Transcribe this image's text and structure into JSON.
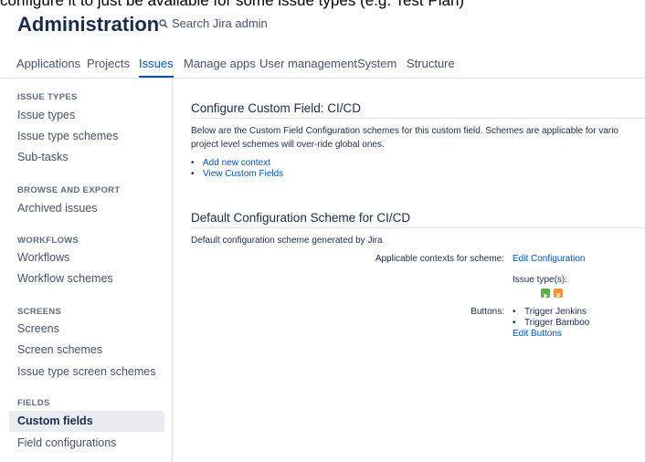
{
  "caption_cut": "configure it to just be available for some issue types (e.g. Test Plan)",
  "header": {
    "title": "Administration",
    "search_placeholder": "Search Jira admin",
    "search_icon": "search-icon"
  },
  "tabs": [
    {
      "label": "Applications"
    },
    {
      "label": "Projects"
    },
    {
      "label": "Issues",
      "active": true
    },
    {
      "label": "Manage apps"
    },
    {
      "label": "User management"
    },
    {
      "label": "System"
    },
    {
      "label": "Structure"
    }
  ],
  "sidebar": {
    "sections": [
      {
        "title": "ISSUE TYPES",
        "items": [
          "Issue types",
          "Issue type schemes",
          "Sub-tasks"
        ]
      },
      {
        "title": "BROWSE AND EXPORT",
        "items": [
          "Archived issues"
        ]
      },
      {
        "title": "WORKFLOWS",
        "items": [
          "Workflows",
          "Workflow schemes"
        ]
      },
      {
        "title": "SCREENS",
        "items": [
          "Screens",
          "Screen schemes",
          "Issue type screen schemes"
        ]
      },
      {
        "title": "FIELDS",
        "items": [
          "Custom fields",
          "Field configurations"
        ]
      }
    ],
    "selected": "Custom fields"
  },
  "main": {
    "heading": "Configure Custom Field: CI/CD",
    "description_line1": "Below are the Custom Field Configuration schemes for this custom field. Schemes are applicable for vario",
    "description_line2": "project level schemes will over-ride global ones.",
    "links": [
      "Add new context",
      "View Custom Fields"
    ],
    "scheme": {
      "heading": "Default Configuration Scheme for CI/CD",
      "description": "Default configuration scheme generated by Jira",
      "contexts_label": "Applicable contexts for scheme:",
      "edit_configuration": "Edit Configuration",
      "issue_types_label": "Issue type(s):",
      "issue_type_icons": [
        "green-play-issue-icon",
        "orange-plan-issue-icon"
      ],
      "buttons_label": "Buttons:",
      "buttons": [
        "Trigger Jenkins",
        "Trigger Bamboo"
      ],
      "edit_buttons": "Edit Buttons"
    }
  },
  "colors": {
    "link": "#0052cc",
    "text": "#172b4d",
    "muted": "#5e6c84",
    "selected_bg": "#ebecf0"
  }
}
